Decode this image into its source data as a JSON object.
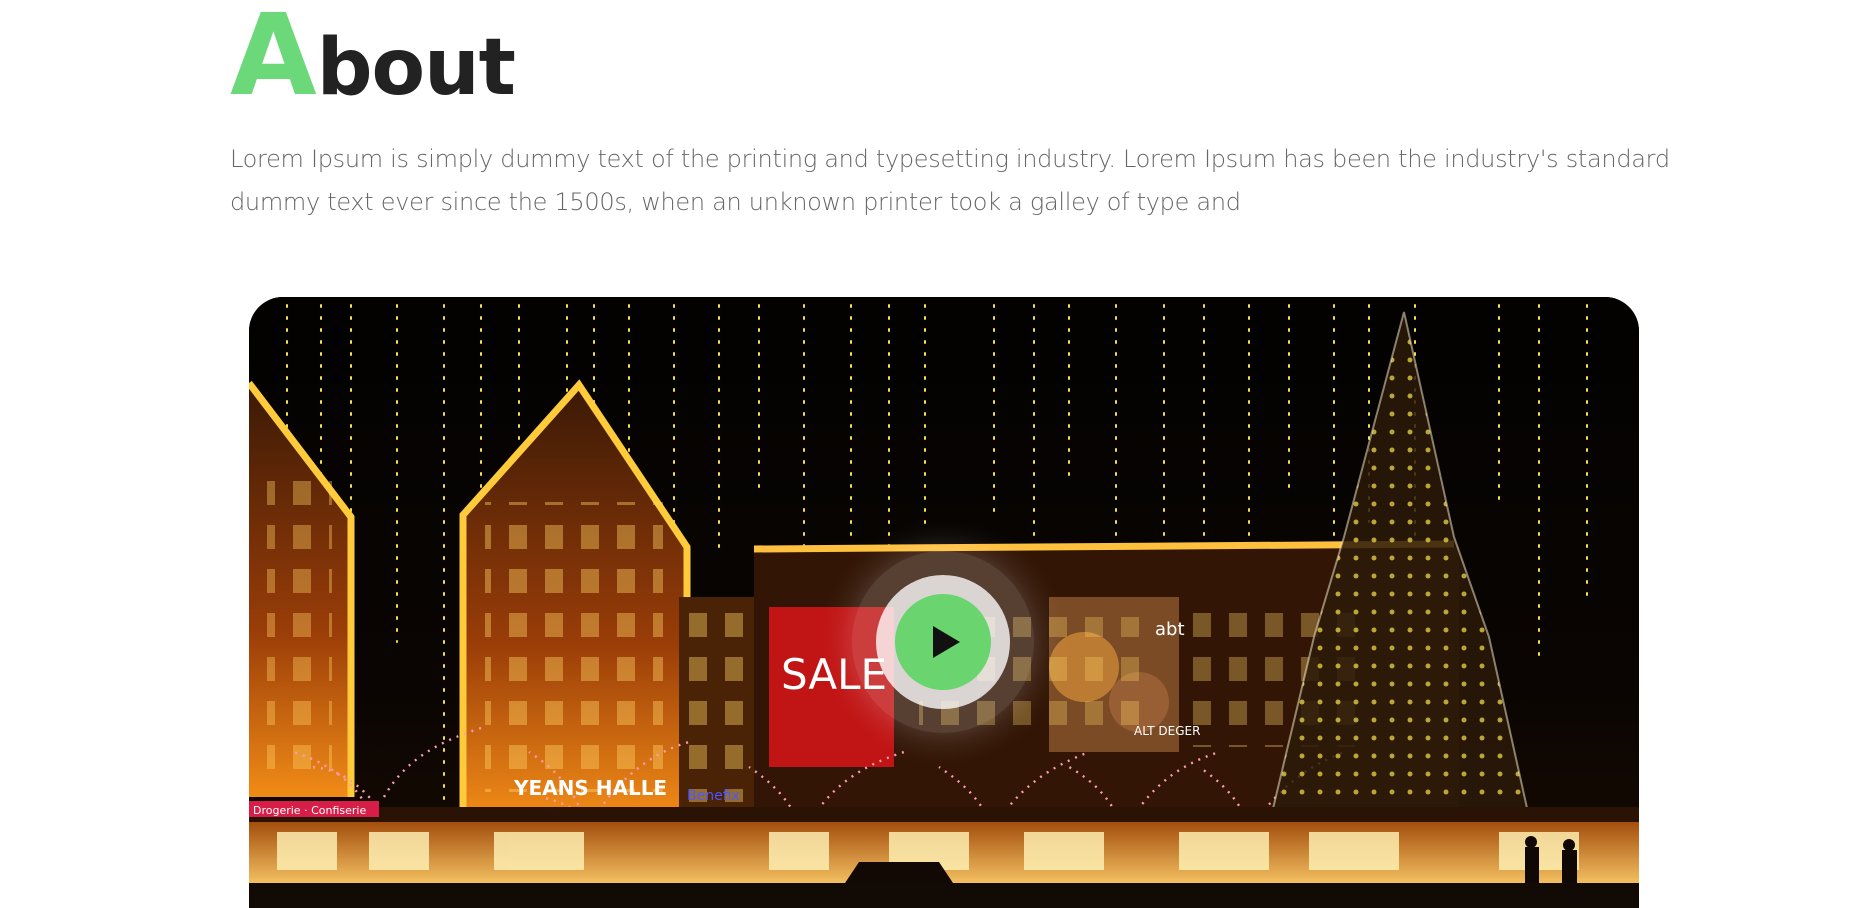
{
  "about": {
    "title_first": "A",
    "title_rest": "bout",
    "text": "Lorem Ipsum is simply dummy text of the printing and typesetting industry. Lorem Ipsum has been the industry's standard dummy text ever since the 1500s, when an unknown printer took a galley of type and"
  },
  "video": {
    "signs": {
      "main": "YEANS HALLE",
      "left": "Drogerie · Confiserie",
      "brand": "abt",
      "blue": "Benefix",
      "poster": "SALE",
      "poster2": "ALT DEGER"
    },
    "icon": "play-icon"
  },
  "colors": {
    "accent": "#6bd87a",
    "heading": "#222222",
    "text": "#666666",
    "play": "#6ad56f"
  }
}
